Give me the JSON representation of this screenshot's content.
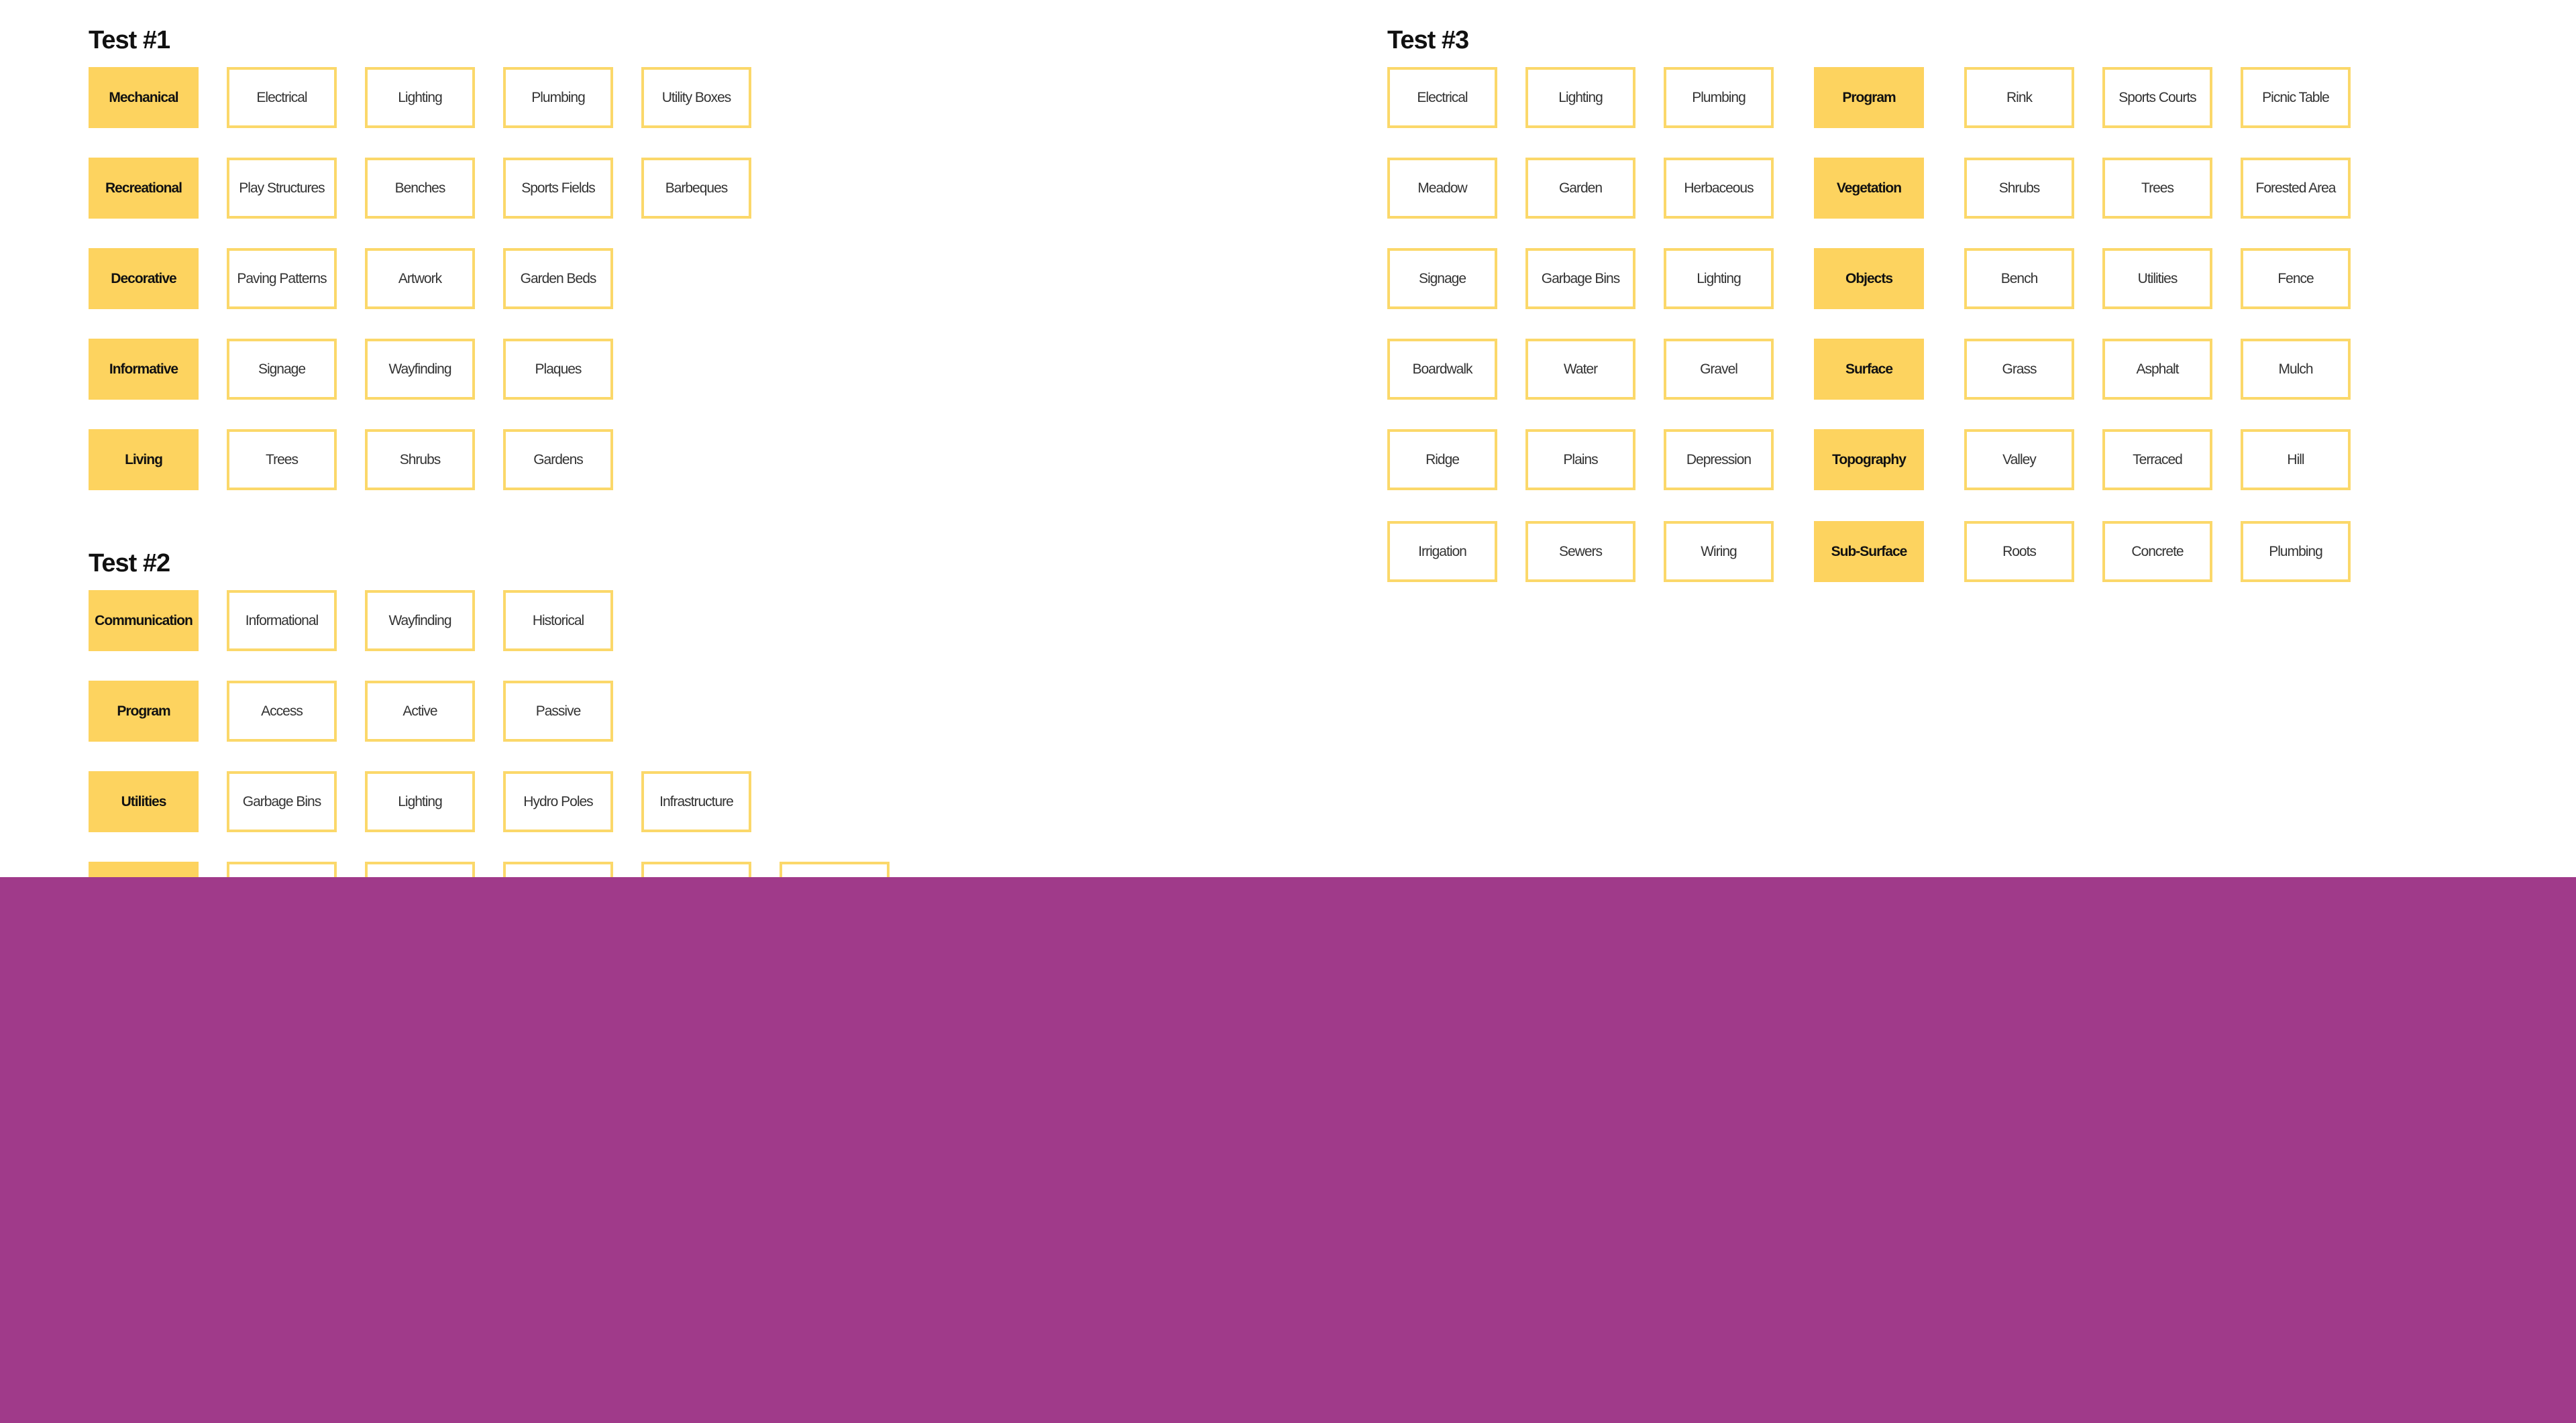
{
  "sections": {
    "test1": {
      "title": "Test #1",
      "rows": [
        {
          "category": "Mechanical",
          "items": [
            "Electrical",
            "Lighting",
            "Plumbing",
            "Utility Boxes"
          ]
        },
        {
          "category": "Recreational",
          "items": [
            "Play Structures",
            "Benches",
            "Sports Fields",
            "Barbeques"
          ]
        },
        {
          "category": "Decorative",
          "items": [
            "Paving Patterns",
            "Artwork",
            "Garden Beds"
          ]
        },
        {
          "category": "Informative",
          "items": [
            "Signage",
            "Wayfinding",
            "Plaques"
          ]
        },
        {
          "category": "Living",
          "items": [
            "Trees",
            "Shrubs",
            "Gardens"
          ]
        }
      ]
    },
    "test2": {
      "title": "Test #2",
      "rows": [
        {
          "category": "Communication",
          "items": [
            "Informational",
            "Wayfinding",
            "Historical"
          ]
        },
        {
          "category": "Program",
          "items": [
            "Access",
            "Active",
            "Passive"
          ]
        },
        {
          "category": "Utilities",
          "items": [
            "Garbage Bins",
            "Lighting",
            "Hydro Poles",
            "Infrastructure"
          ]
        }
      ]
    },
    "test3": {
      "title": "Test #3",
      "rows": [
        {
          "left": [
            "Electrical",
            "Lighting",
            "Plumbing"
          ],
          "category": "Program",
          "right": [
            "Rink",
            "Sports Courts",
            "Picnic Table"
          ]
        },
        {
          "left": [
            "Meadow",
            "Garden",
            "Herbaceous"
          ],
          "category": "Vegetation",
          "right": [
            "Shrubs",
            "Trees",
            "Forested Area"
          ]
        },
        {
          "left": [
            "Signage",
            "Garbage Bins",
            "Lighting"
          ],
          "category": "Objects",
          "right": [
            "Bench",
            "Utilities",
            "Fence"
          ]
        },
        {
          "left": [
            "Boardwalk",
            "Water",
            "Gravel"
          ],
          "category": "Surface",
          "right": [
            "Grass",
            "Asphalt",
            "Mulch"
          ]
        },
        {
          "left": [
            "Ridge",
            "Plains",
            "Depression"
          ],
          "category": "Topography",
          "right": [
            "Valley",
            "Terraced",
            "Hill"
          ]
        },
        {
          "left": [
            "Irrigation",
            "Sewers",
            "Wiring"
          ],
          "category": "Sub-Surface",
          "right": [
            "Roots",
            "Concrete",
            "Plumbing"
          ]
        }
      ]
    }
  },
  "colors": {
    "category_fill": "#fdd35f",
    "chip_border": "#fbd86a",
    "overlay": "#a03a8a"
  }
}
